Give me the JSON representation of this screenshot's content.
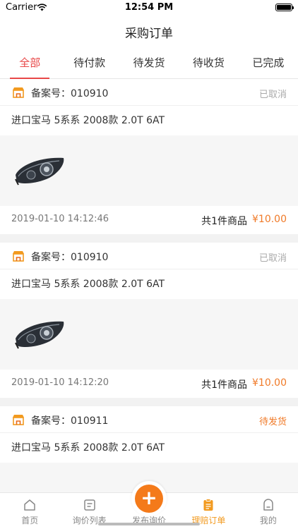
{
  "status_bar": {
    "carrier": "Carrier",
    "time": "12:54 PM"
  },
  "nav": {
    "title": "采购订单"
  },
  "tabs": [
    {
      "label": "全部",
      "active": true
    },
    {
      "label": "待付款",
      "active": false
    },
    {
      "label": "待发货",
      "active": false
    },
    {
      "label": "待收货",
      "active": false
    },
    {
      "label": "已完成",
      "active": false
    }
  ],
  "orders": [
    {
      "record_label": "备案号：010910",
      "status": "已取消",
      "title": "进口宝马 5系系 2008款 2.0T 6AT",
      "time": "2019-01-10 14:12:46",
      "count": "共1件商品",
      "price": "¥10.00"
    },
    {
      "record_label": "备案号：010910",
      "status": "已取消",
      "title": "进口宝马 5系系 2008款 2.0T 6AT",
      "time": "2019-01-10 14:12:20",
      "count": "共1件商品",
      "price": "¥10.00"
    },
    {
      "record_label": "备案号：010911",
      "status": "待发货",
      "title": "进口宝马 5系系 2008款 2.0T 6AT"
    }
  ],
  "tab_bar": [
    {
      "label": "首页",
      "icon": "home-icon"
    },
    {
      "label": "询价列表",
      "icon": "list-icon"
    },
    {
      "label": "发布询价",
      "icon": "plus-icon"
    },
    {
      "label": "理赔订单",
      "icon": "clipboard-icon",
      "active": true
    },
    {
      "label": "我的",
      "icon": "profile-icon"
    }
  ],
  "colors": {
    "accent_red": "#e84848",
    "accent_orange": "#f07a28",
    "tab_active": "#f29a1f"
  }
}
